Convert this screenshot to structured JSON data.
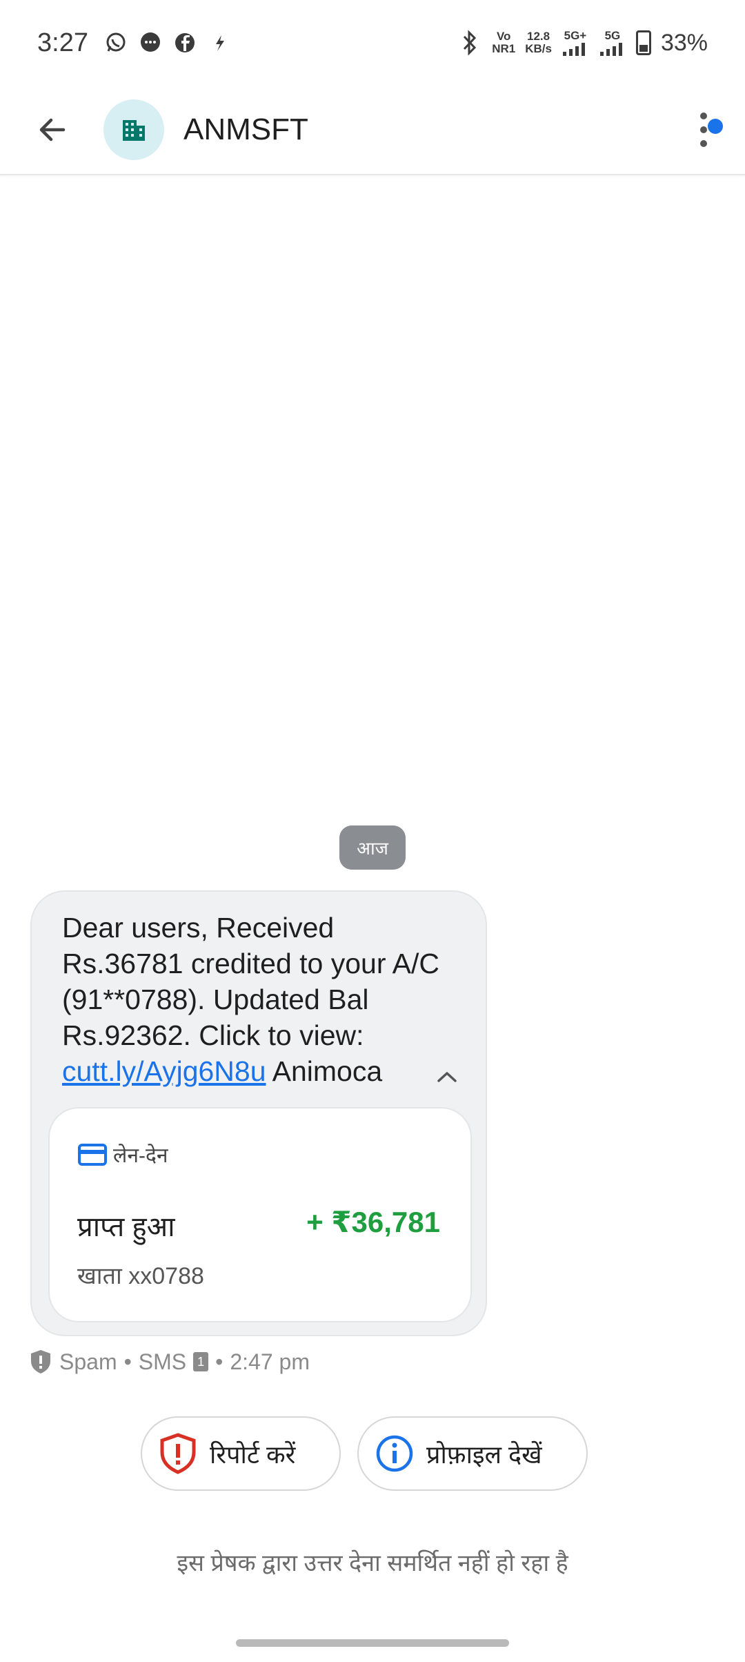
{
  "status_bar": {
    "time": "3:27",
    "network_top": "Vo",
    "network_bottom": "NR1",
    "speed_top": "12.8",
    "speed_bottom": "KB/s",
    "sig1": "5G+",
    "sig2": "5G",
    "battery": "33%"
  },
  "header": {
    "contact_name": "ANMSFT",
    "avatar_icon": "building-icon"
  },
  "date_chip": "आज",
  "message": {
    "text_before_link": "Dear users, Received Rs.36781 credited to your A/C (91**0788). Updated Bal Rs.92362. Click to view: ",
    "link": "cutt.ly/Ayjg6N8u",
    "text_after_link": " Animoca"
  },
  "transaction": {
    "category": "लेन-देन",
    "label": "प्राप्त हुआ",
    "amount": "+ ₹36,781",
    "account": "खाता xx0788"
  },
  "meta": {
    "spam": "Spam",
    "type": "SMS",
    "sim": "1",
    "time": "2:47 pm"
  },
  "actions": {
    "report": "रिपोर्ट करें",
    "profile": "प्रोफ़ाइल देखें"
  },
  "footer_note": "इस प्रेषक द्वारा उत्तर देना समर्थित नहीं हो रहा है",
  "colors": {
    "accent": "#1a73e8",
    "amount_green": "#1e9e3e",
    "report_red": "#d93025"
  }
}
